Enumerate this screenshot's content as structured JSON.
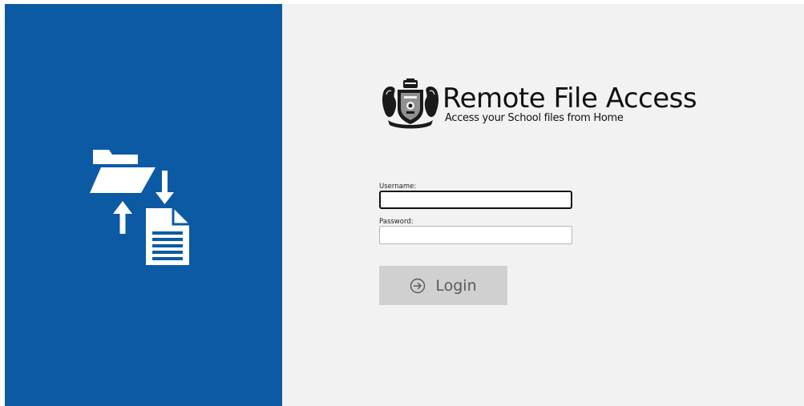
{
  "app": {
    "title": "Remote File Access",
    "subtitle": "Access your School files from Home"
  },
  "form": {
    "username_label": "Username:",
    "username_value": "",
    "password_label": "Password:",
    "password_value": ""
  },
  "login_button": {
    "label": "Login",
    "icon": "arrow-circle-right-icon"
  },
  "graphics": {
    "left_panel_icon": "file-transfer-icon",
    "logo": "school-crest-icon"
  },
  "colors": {
    "left_panel_bg": "#0b5aa3",
    "right_panel_bg": "#f2f2f2",
    "button_bg": "#d0d0d0",
    "button_text": "#5a5a5a"
  }
}
